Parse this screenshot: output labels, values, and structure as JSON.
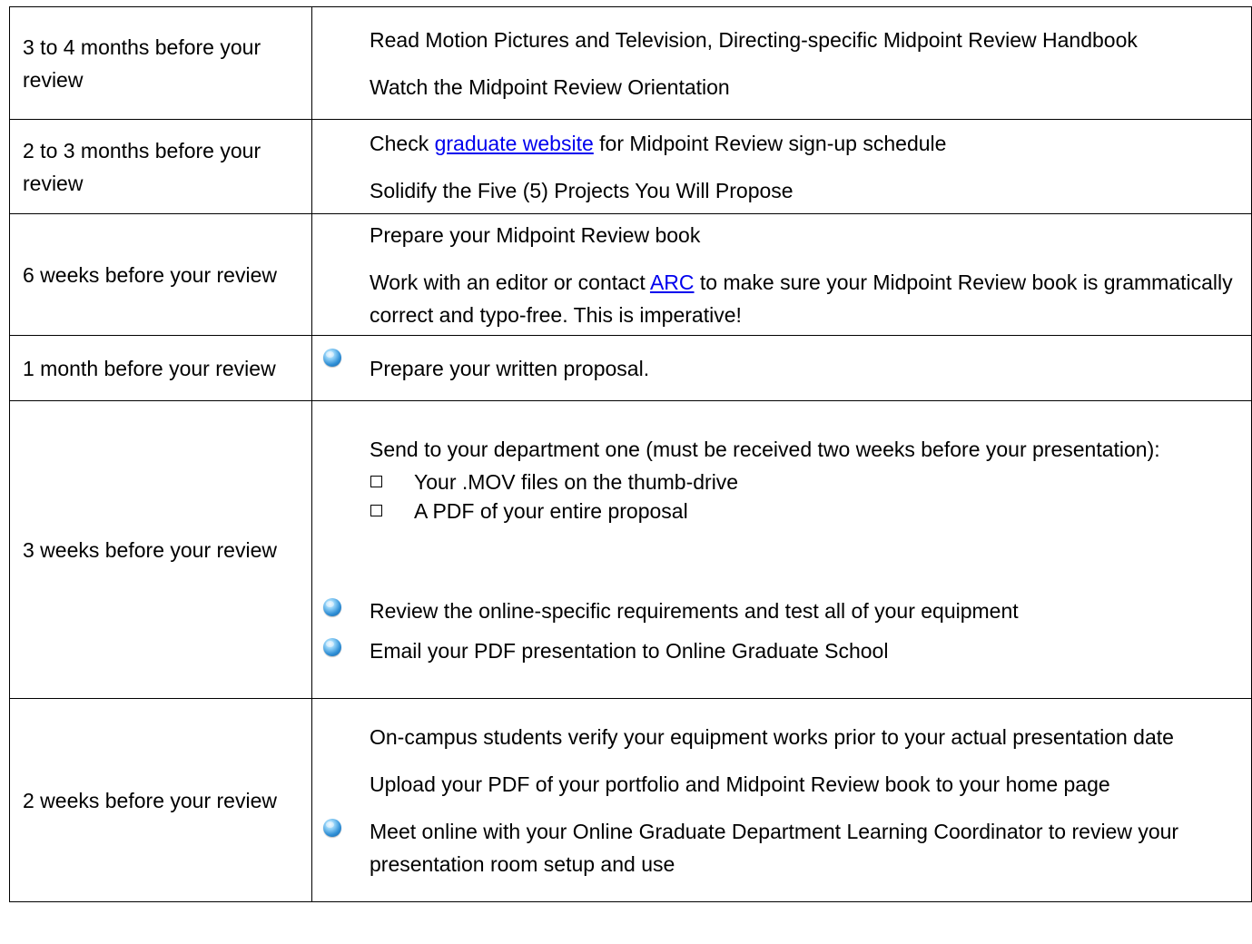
{
  "rows": [
    {
      "when": "3 to 4 months before your review",
      "tasks": [
        {
          "text": "Read Motion Pictures and Television, Directing-specific Midpoint Review Handbook"
        },
        {
          "text": "Watch the Midpoint Review Orientation"
        }
      ]
    },
    {
      "when": "2 to 3 months before your review",
      "tasks": [
        {
          "pre": "Check ",
          "link": "graduate website",
          "post": " for Midpoint Review sign-up schedule"
        },
        {
          "text": "Solidify the Five (5) Projects You Will Propose"
        }
      ]
    },
    {
      "when": "6 weeks before your review",
      "tasks": [
        {
          "text": "Prepare your Midpoint Review book"
        },
        {
          "pre": "Work with an editor or contact ",
          "link": "ARC",
          "post": " to make sure your Midpoint Review book is grammatically correct and typo-free.  This is imperative!"
        }
      ]
    },
    {
      "when": "1 month before your review",
      "tasks": [
        {
          "text": "Prepare your written proposal.",
          "icon": "globe-icon"
        }
      ]
    },
    {
      "when": "3 weeks before your review",
      "tasks": [
        {
          "text": "Send to your department one (must be received two weeks before your presentation):"
        },
        {
          "checklist": [
            "Your .MOV files on the thumb-drive",
            "A PDF of your entire proposal"
          ]
        },
        {
          "text": "Review the online-specific requirements and test all of your equipment",
          "icon": "globe-icon"
        },
        {
          "text": "Email your PDF presentation to Online Graduate School",
          "icon": "globe-icon"
        }
      ]
    },
    {
      "when": "2 weeks before your review",
      "tasks": [
        {
          "text": "On-campus students verify your equipment works prior to your actual presentation date"
        },
        {
          "text": "Upload your PDF of your portfolio and Midpoint Review book to your home page"
        },
        {
          "text": "Meet online with your Online Graduate Department Learning Coordinator to review your presentation room setup and use",
          "icon": "globe-icon"
        }
      ]
    }
  ],
  "colors": {
    "link": "#0000ee",
    "border": "#000000",
    "globe": "#2f8fd6"
  }
}
